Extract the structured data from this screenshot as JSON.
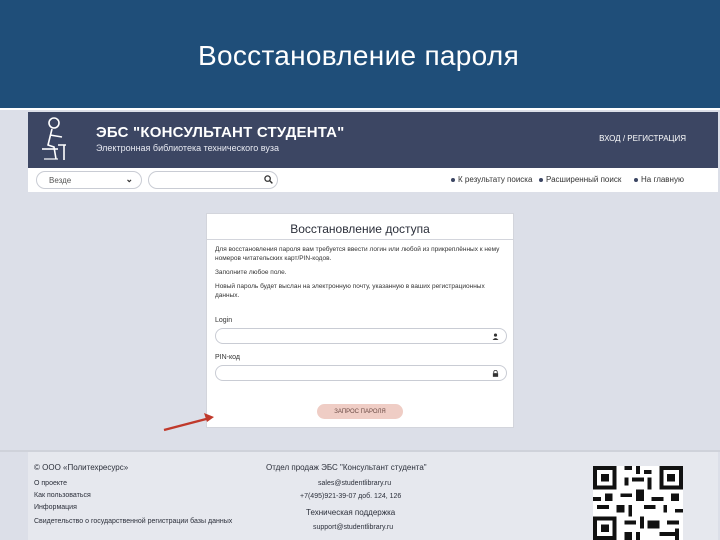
{
  "slide": {
    "title": "Восстановление пароля"
  },
  "header": {
    "brand_name": "ЭБС \"КОНСУЛЬТАНТ СТУДЕНТА\"",
    "brand_sub": "Электронная библиотека технического вуза",
    "login_link": "ВХОД / РЕГИСТРАЦИЯ"
  },
  "search": {
    "scope_value": "Везде",
    "query": "",
    "links": [
      "К результату поиска",
      "Расширенный поиск",
      "На главную"
    ]
  },
  "recovery_form": {
    "title": "Восстановление доступа",
    "paragraph_1": "Для восстановления пароля вам требуется ввести логин или любой из прикреплённых к нему номеров читательских карт/PIN-кодов.",
    "paragraph_2": "Заполните любое поле.",
    "paragraph_3": "Новый пароль будет выслан на электронную почту, указанную в ваших регистрационных данных.",
    "login_label": "Login",
    "login_value": "",
    "pin_label": "PIN-код",
    "pin_value": "",
    "submit_label": "ЗАПРОС ПАРОЛЯ"
  },
  "footer": {
    "copyright": "© ООО «Политехресурс»",
    "links": [
      "О проекте",
      "Как пользоваться",
      "Информация",
      "Свидетельство о государственной регистрации базы данных"
    ],
    "sales_title": "Отдел продаж ЭБС \"Консультант студента\"",
    "sales_email": "sales@studentlibrary.ru",
    "sales_phone": "+7(495)921-39-07 доб. 124, 126",
    "support_title": "Техническая поддержка",
    "support_email": "support@studentlibrary.ru"
  },
  "colors": {
    "slide_header": "#1f4e79",
    "site_header": "#3c4663",
    "button": "#efcdc5",
    "arrow": "#c0392b"
  }
}
